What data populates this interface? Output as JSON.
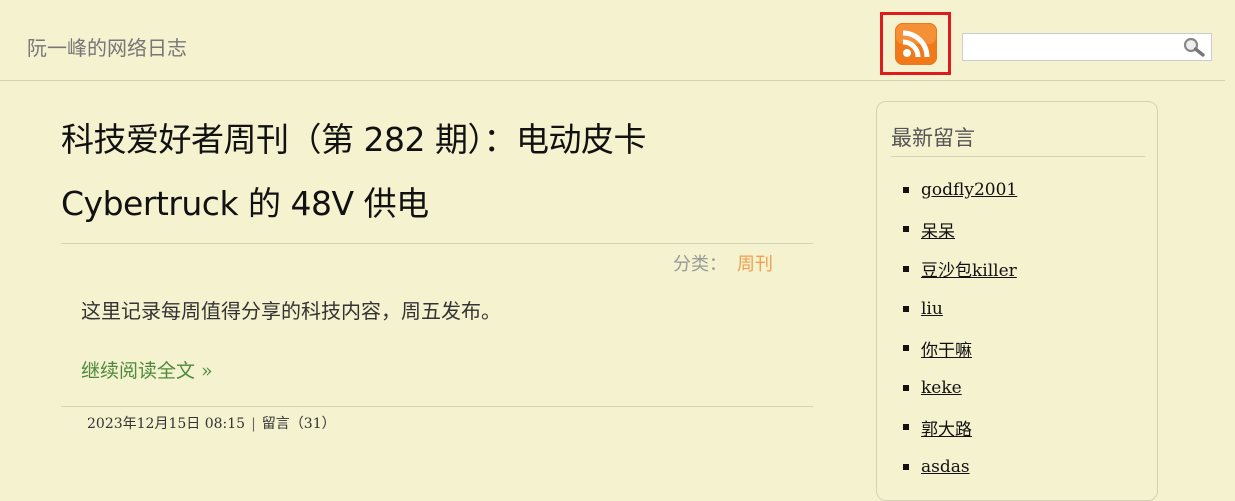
{
  "header": {
    "site_title": "阮一峰的网络日志",
    "rss_icon": "rss-icon",
    "search": {
      "value": "",
      "placeholder": ""
    },
    "search_icon": "search-icon"
  },
  "article": {
    "title": "科技爱好者周刊（第 282 期）：电动皮卡 Cybertruck 的 48V 供电",
    "category_label": "分类：",
    "category_value": "周刊",
    "summary": "这里记录每周值得分享的科技内容，周五发布。",
    "read_more": "继续阅读全文 »",
    "date": "2023年12月15日 08:15",
    "separator": "|",
    "comments": "留言（31）"
  },
  "sidebar": {
    "title": "最新留言",
    "comments": [
      "godfly2001",
      "呆呆",
      "豆沙包killer",
      "liu",
      "你干嘛",
      "keke",
      "郭大路",
      "asdas"
    ]
  },
  "colors": {
    "background": "#f5f2d0",
    "highlight_border": "#e01b1b",
    "category_link": "#f0a050",
    "read_more_link": "#4d8a3b",
    "rss_orange": "#f07a1a"
  }
}
